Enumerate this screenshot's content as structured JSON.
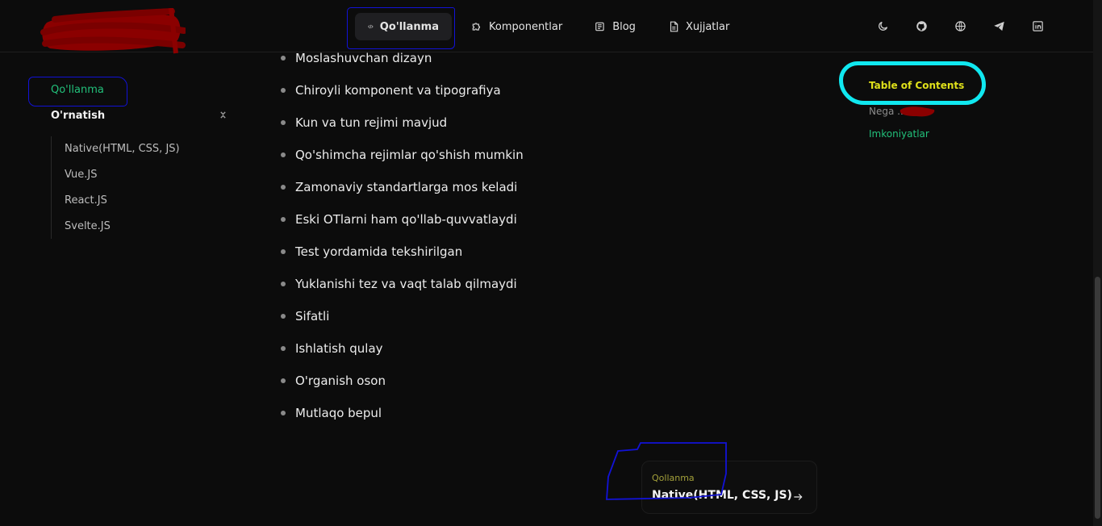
{
  "header": {
    "nav": [
      {
        "label": "Qo'llanma",
        "icon": "code-icon",
        "active": true
      },
      {
        "label": "Komponentlar",
        "icon": "puzzle-icon",
        "active": false
      },
      {
        "label": "Blog",
        "icon": "newspaper-icon",
        "active": false
      },
      {
        "label": "Xujjatlar",
        "icon": "document-icon",
        "active": false
      }
    ],
    "right_icons": [
      "moon-icon",
      "github-icon",
      "globe-icon",
      "telegram-icon",
      "linkedin-icon"
    ]
  },
  "sidebar": {
    "section_title": "Qo'llanma",
    "group_title": "O'rnatish",
    "items": [
      {
        "label": "Native(HTML, CSS, JS)"
      },
      {
        "label": "Vue.JS"
      },
      {
        "label": "React.JS"
      },
      {
        "label": "Svelte.JS"
      }
    ]
  },
  "main": {
    "features": [
      "Moslashuvchan dizayn",
      "Chiroyli komponent va tipografiya",
      "Kun va tun rejimi mavjud",
      "Qo'shimcha rejimlar qo'shish mumkin",
      "Zamonaviy standartlarga mos keladi",
      "Eski OTlarni ham qo'llab-quvvatlaydi",
      "Test yordamida tekshirilgan",
      "Yuklanishi tez va vaqt talab qilmaydi",
      "Sifatli",
      "Ishlatish qulay",
      "O'rganish oson",
      "Mutlaqo bepul"
    ]
  },
  "toc": {
    "title": "Table of Contents",
    "links": [
      "Nega ...?",
      "Imkoniyatlar"
    ]
  },
  "pager": {
    "label": "Qollanma",
    "title": "Native(HTML, CSS, JS)"
  },
  "colors": {
    "background": "#0c0c0c",
    "accent_green": "#22c07a",
    "toc_title": "#dfe01a",
    "annotation_blue": "#1212d6",
    "annotation_cyan": "#10e8f0",
    "redaction_red": "#8b0000"
  }
}
